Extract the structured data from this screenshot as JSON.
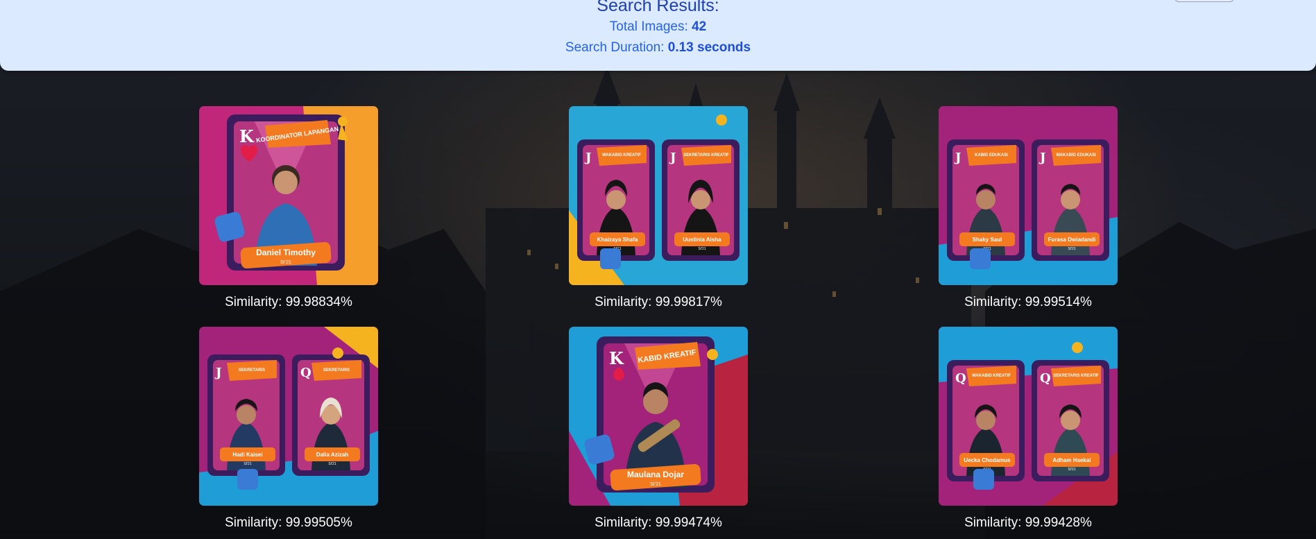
{
  "header": {
    "title": "Search Results:",
    "total_label": "Total Images:",
    "total_value": "42",
    "duration_label": "Search Duration:",
    "duration_value": "0.13 seconds"
  },
  "results": [
    {
      "similarity": "Similarity: 99.98834%",
      "cards": [
        {
          "rank": "K",
          "role": "KOORDINATOR LAPANGAN",
          "name": "Daniel Timothy",
          "year": "SI'21"
        }
      ]
    },
    {
      "similarity": "Similarity: 99.99817%",
      "cards": [
        {
          "rank": "J",
          "role": "WAKABID KREATIF",
          "name": "Khaizaya Shafa",
          "year": "SI'21"
        },
        {
          "rank": "J",
          "role": "SEKRETARIS KREATIF",
          "name": "Uustinia Aisha",
          "year": "SI'21"
        }
      ]
    },
    {
      "similarity": "Similarity: 99.99514%",
      "cards": [
        {
          "rank": "J",
          "role": "KABID EDUKASI",
          "name": "Shaky Saul",
          "year": "SI'21"
        },
        {
          "rank": "J",
          "role": "WAKABID EDUKASI",
          "name": "Furasa Dwiadandi",
          "year": "SI'21"
        }
      ]
    },
    {
      "similarity": "Similarity: 99.99505%",
      "cards": [
        {
          "rank": "J",
          "role": "SEKRETARIS",
          "name": "Hadi Kaisei",
          "year": "SI'21"
        },
        {
          "rank": "Q",
          "role": "SEKRETARIS",
          "name": "Dalia Azizah",
          "year": "SI'21"
        }
      ]
    },
    {
      "similarity": "Similarity: 99.99474%",
      "cards": [
        {
          "rank": "K",
          "role": "KABID KREATIF",
          "name": "Maulana Dojar",
          "year": "SI'21"
        }
      ]
    },
    {
      "similarity": "Similarity: 99.99428%",
      "cards": [
        {
          "rank": "Q",
          "role": "WAKABID KREATIF",
          "name": "Uecka Chodamus",
          "year": "SI'21"
        },
        {
          "rank": "Q",
          "role": "SEKRETARIS KREATIF",
          "name": "Adham Haekal",
          "year": "SI'21"
        }
      ]
    }
  ]
}
